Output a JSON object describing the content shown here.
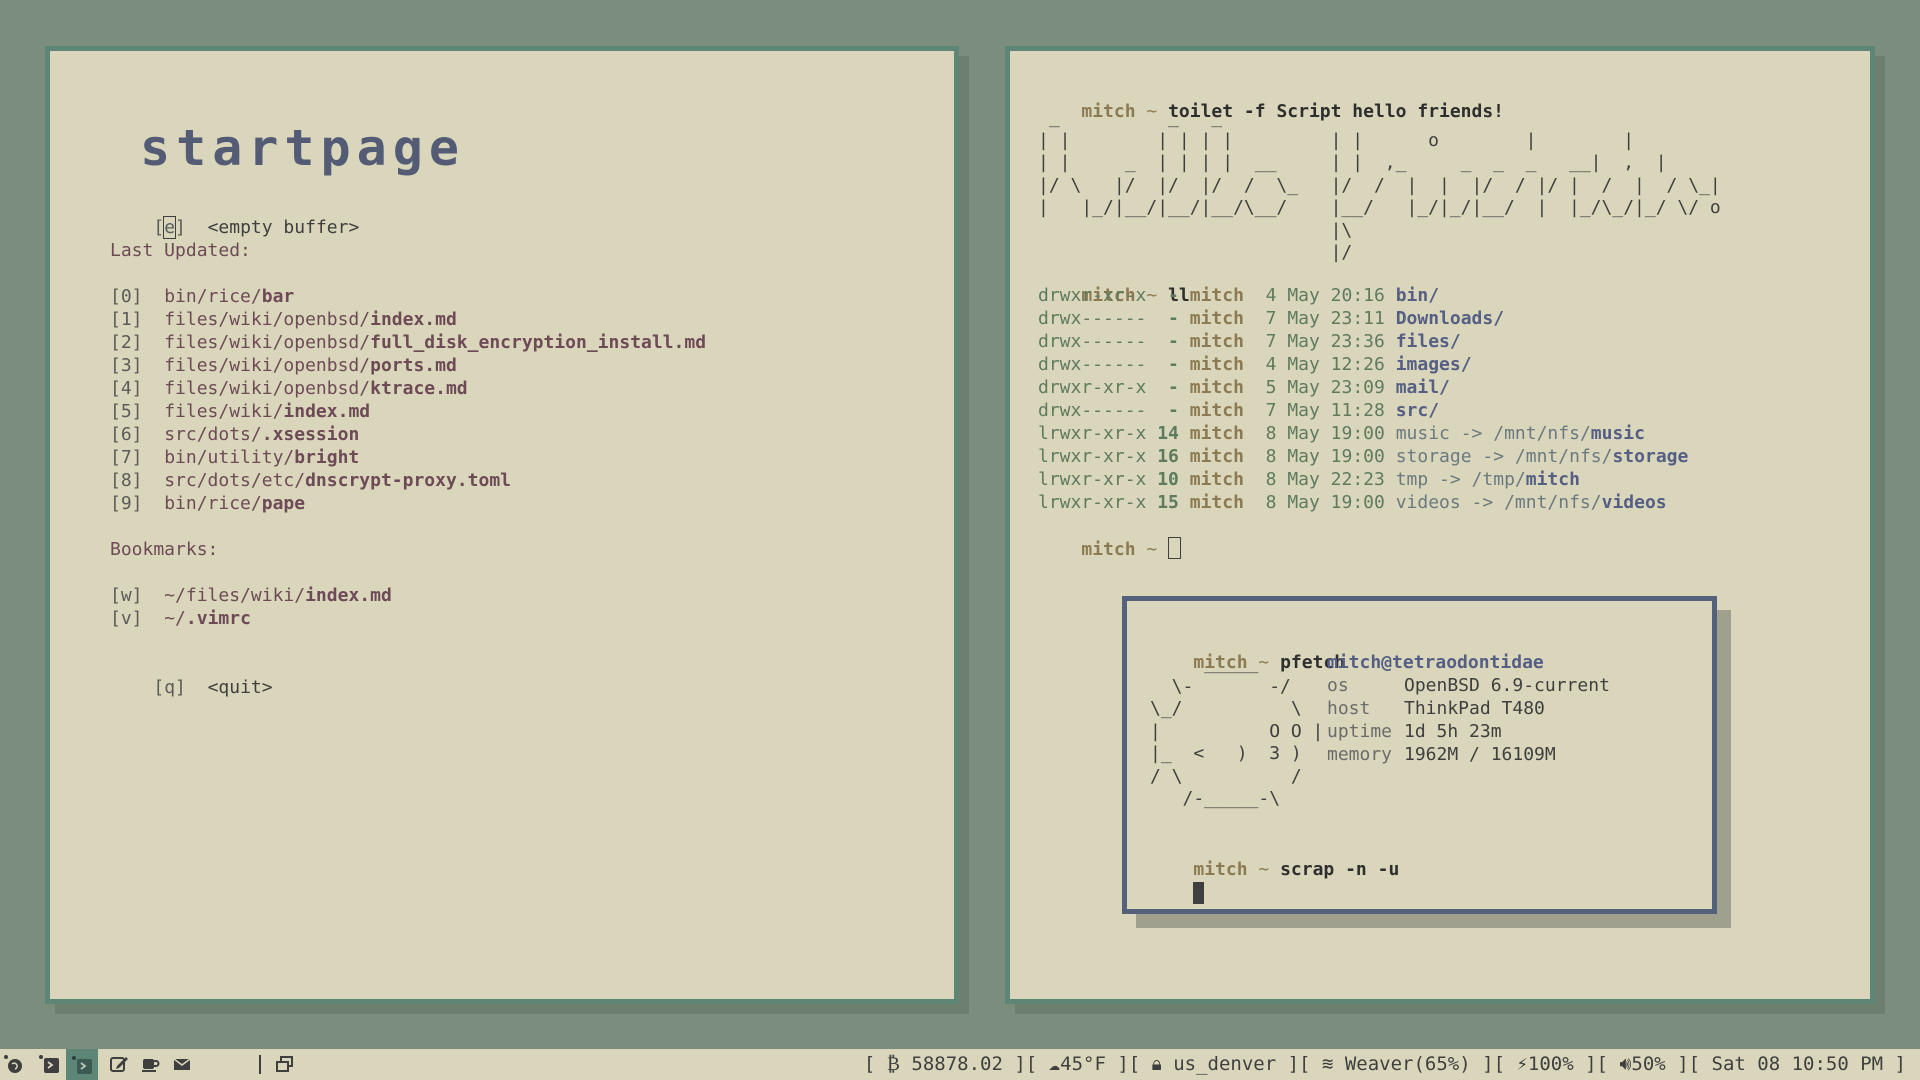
{
  "startpage": {
    "title": "startpage",
    "empty": {
      "key_l": "[",
      "key_c": "e",
      "key_r": "]",
      "label": "<empty buffer>"
    },
    "last_updated_label": "Last Updated:",
    "items": [
      {
        "key": "[0]",
        "path": "bin/rice/",
        "file": "bar"
      },
      {
        "key": "[1]",
        "path": "files/wiki/openbsd/",
        "file": "index.md"
      },
      {
        "key": "[2]",
        "path": "files/wiki/openbsd/",
        "file": "full_disk_encryption_install.md"
      },
      {
        "key": "[3]",
        "path": "files/wiki/openbsd/",
        "file": "ports.md"
      },
      {
        "key": "[4]",
        "path": "files/wiki/openbsd/",
        "file": "ktrace.md"
      },
      {
        "key": "[5]",
        "path": "files/wiki/",
        "file": "index.md"
      },
      {
        "key": "[6]",
        "path": "src/dots/",
        "file": ".xsession"
      },
      {
        "key": "[7]",
        "path": "bin/utility/",
        "file": "bright"
      },
      {
        "key": "[8]",
        "path": "src/dots/etc/",
        "file": "dnscrypt-proxy.toml"
      },
      {
        "key": "[9]",
        "path": "bin/rice/",
        "file": "pape"
      }
    ],
    "bookmarks_label": "Bookmarks:",
    "bookmarks": [
      {
        "key": "[w]",
        "path": "~/files/wiki/",
        "file": "index.md"
      },
      {
        "key": "[v]",
        "path": "~/",
        "file": ".vimrc"
      }
    ],
    "quit": {
      "key": "[q]",
      "label": "<quit>"
    }
  },
  "terminal": {
    "prompt_user": "mitch",
    "prompt_sep": "~",
    "cmd1": "toilet -f Script hello friends!",
    "ascii_art": [
      " _          _   _                ",
      "| |        | | | |         | |      o        |        |",
      "| |     _  | | | |  __     | |  ,_     _  _  _   __|  ,  |",
      "|/ \\   |/  |/  |/  /  \\_   |/  /  |  |  |/  / |/ |  /  |  / \\_|",
      "|   |_/|__/|__/|__/\\__/    |__/   |_/|_/|__/  |  |_/\\_/|_/ \\/ o",
      "                           |\\",
      "                           |/"
    ],
    "cmd2": "ll",
    "listing": [
      {
        "perm": "drwxr-xr-x",
        "links": " -",
        "owner": "mitch",
        "day": "4",
        "mon": "May",
        "time": "20:16",
        "name": "bin/",
        "target_path": "",
        "target": ""
      },
      {
        "perm": "drwx------",
        "links": " -",
        "owner": "mitch",
        "day": "7",
        "mon": "May",
        "time": "23:11",
        "name": "Downloads/",
        "target_path": "",
        "target": ""
      },
      {
        "perm": "drwx------",
        "links": " -",
        "owner": "mitch",
        "day": "7",
        "mon": "May",
        "time": "23:36",
        "name": "files/",
        "target_path": "",
        "target": ""
      },
      {
        "perm": "drwx------",
        "links": " -",
        "owner": "mitch",
        "day": "4",
        "mon": "May",
        "time": "12:26",
        "name": "images/",
        "target_path": "",
        "target": ""
      },
      {
        "perm": "drwxr-xr-x",
        "links": " -",
        "owner": "mitch",
        "day": "5",
        "mon": "May",
        "time": "23:09",
        "name": "mail/",
        "target_path": "",
        "target": ""
      },
      {
        "perm": "drwx------",
        "links": " -",
        "owner": "mitch",
        "day": "7",
        "mon": "May",
        "time": "11:28",
        "name": "src/",
        "target_path": "",
        "target": ""
      },
      {
        "perm": "lrwxr-xr-x",
        "links": "14",
        "owner": "mitch",
        "day": "8",
        "mon": "May",
        "time": "19:00",
        "name": "music -> ",
        "target_path": "/mnt/nfs/",
        "target": "music"
      },
      {
        "perm": "lrwxr-xr-x",
        "links": "16",
        "owner": "mitch",
        "day": "8",
        "mon": "May",
        "time": "19:00",
        "name": "storage -> ",
        "target_path": "/mnt/nfs/",
        "target": "storage"
      },
      {
        "perm": "lrwxr-xr-x",
        "links": "10",
        "owner": "mitch",
        "day": "8",
        "mon": "May",
        "time": "22:23",
        "name": "tmp -> ",
        "target_path": "/tmp/",
        "target": "mitch"
      },
      {
        "perm": "lrwxr-xr-x",
        "links": "15",
        "owner": "mitch",
        "day": "8",
        "mon": "May",
        "time": "19:00",
        "name": "videos -> ",
        "target_path": "/mnt/nfs/",
        "target": "videos"
      }
    ]
  },
  "pfetch": {
    "cmd": "pfetch",
    "logo": [
      "     _____",
      "  \\-       -/",
      "\\_/          \\",
      "|          O O |",
      "|_  <   )  3 )",
      "/ \\          /",
      "   /-_____-\\"
    ],
    "user_host": "mitch@tetraodontidae",
    "rows": [
      {
        "k": "os",
        "v": "OpenBSD 6.9-current"
      },
      {
        "k": "host",
        "v": "ThinkPad T480"
      },
      {
        "k": "uptime",
        "v": "1d 5h 23m"
      },
      {
        "k": "memory",
        "v": "1962M / 16109M"
      }
    ],
    "cmd2": "scrap -n -u"
  },
  "taskbar": {
    "btc": "58878.02",
    "weather": "45°F",
    "vpn": "us_denver",
    "wifi": "Weaver(65%)",
    "battery": "100%",
    "volume": "50%",
    "datetime": "Sat 08 10:50 PM"
  }
}
